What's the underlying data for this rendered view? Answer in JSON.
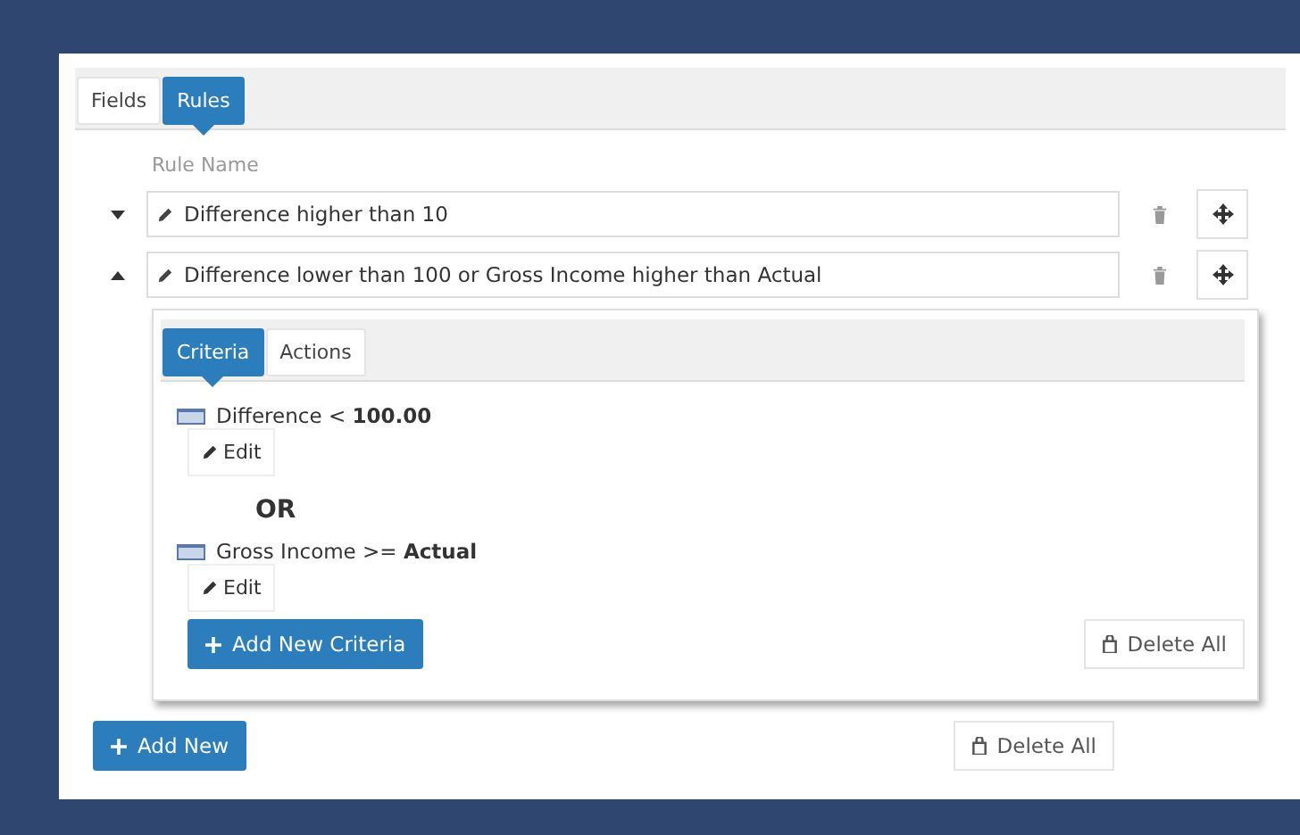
{
  "tabs": [
    {
      "label": "Fields",
      "selected": false
    },
    {
      "label": "Rules",
      "selected": true
    }
  ],
  "rule_name_label": "Rule Name",
  "rules": [
    {
      "name": "Difference higher than 10",
      "expanded": false
    },
    {
      "name": "Difference lower than 100 or Gross Income higher than Actual",
      "expanded": true,
      "sub_tabs": [
        {
          "label": "Criteria",
          "selected": true
        },
        {
          "label": "Actions",
          "selected": false
        }
      ],
      "criteria": [
        {
          "text": "Difference < **100.00**",
          "edit": "Edit"
        },
        {
          "connector": "OR",
          "text": "Gross Income >= **Actual**",
          "edit": "Edit"
        }
      ],
      "add_button": "Add New Criteria",
      "delete_button": "Delete All"
    }
  ],
  "add_button": "Add New",
  "delete_button": "Delete All"
}
